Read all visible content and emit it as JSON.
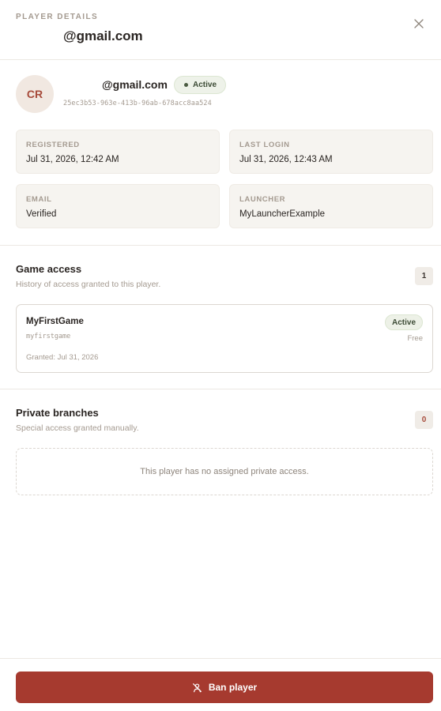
{
  "header": {
    "eyebrow": "PLAYER DETAILS",
    "title": "@gmail.com",
    "close_icon": "close-icon"
  },
  "profile": {
    "initials": "CR",
    "email": "@gmail.com",
    "status": "Active",
    "uuid": "25ec3b53-963e-413b-96ab-678acc8aa524",
    "accent_color": "#a64a3a",
    "status_color": "#4a5b41"
  },
  "info": {
    "registered": {
      "label": "REGISTERED",
      "value": "Jul 31, 2026, 12:42 AM"
    },
    "last_login": {
      "label": "LAST LOGIN",
      "value": "Jul 31, 2026, 12:43 AM"
    },
    "email": {
      "label": "EMAIL",
      "value": "Verified"
    },
    "launcher": {
      "label": "LAUNCHER",
      "value": "MyLauncherExample"
    }
  },
  "game_access": {
    "title": "Game access",
    "subtitle": "History of access granted to this player.",
    "count": "1",
    "items": [
      {
        "name": "MyFirstGame",
        "slug": "myfirstgame",
        "granted": "Granted: Jul 31, 2026",
        "status": "Active",
        "price": "Free"
      }
    ]
  },
  "private_branches": {
    "title": "Private branches",
    "subtitle": "Special access granted manually.",
    "count": "0",
    "empty_text": "This player has no assigned private access."
  },
  "footer": {
    "ban_label": "Ban player",
    "ban_icon": "user-off-icon",
    "ban_color": "#a63a2f"
  }
}
